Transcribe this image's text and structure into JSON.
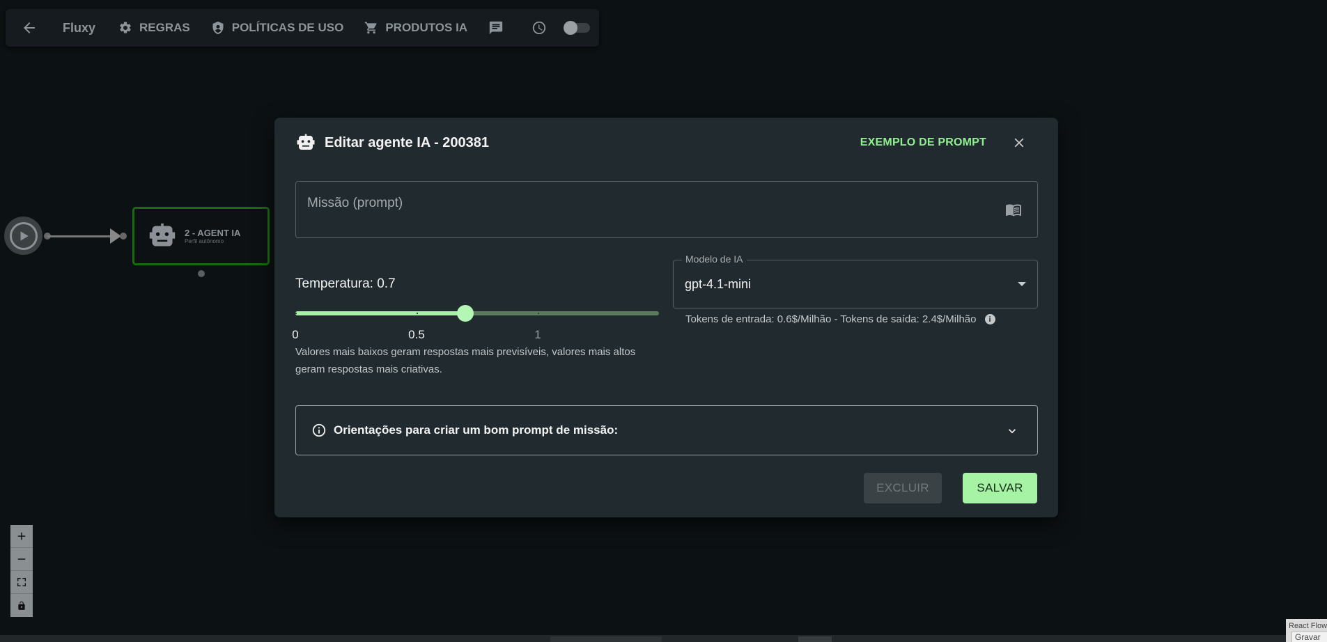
{
  "toolbar": {
    "brand": "Fluxy",
    "rules_label": "REGRAS",
    "policies_label": "POLÍTICAS DE USO",
    "ai_products_label": "PRODUTOS IA"
  },
  "canvas": {
    "agent_node": {
      "title": "2 - AGENT IA",
      "subtitle": "Perfil autônomo"
    },
    "attribution": "React Flow",
    "attribution_button": "Gravar"
  },
  "modal": {
    "title": "Editar agente IA - 200381",
    "example_prompt_link": "EXEMPLO DE PROMPT",
    "prompt_placeholder": "Missão (prompt)",
    "temperature": {
      "label": "Temperatura: 0.7",
      "value": 0.7,
      "min": 0,
      "max": 1.5,
      "marks": [
        "0",
        "0.5",
        "1"
      ],
      "help": "Valores mais baixos geram respostas mais previsíveis, valores mais altos geram respostas mais criativas."
    },
    "model": {
      "legend": "Modelo de IA",
      "selected": "gpt-4.1-mini",
      "tokens_info": "Tokens de entrada: 0.6$/Milhão - Tokens de saída: 2.4$/Milhão"
    },
    "guidelines_label": "Orientações para criar um bom prompt de missão:",
    "delete_label": "EXCLUIR",
    "save_label": "SALVAR"
  },
  "colors": {
    "accent": "#a6f3a6",
    "link": "#8ff08f",
    "modal_bg": "#212a2e",
    "canvas_bg": "#0c1113",
    "node_border": "#1a6a12"
  }
}
